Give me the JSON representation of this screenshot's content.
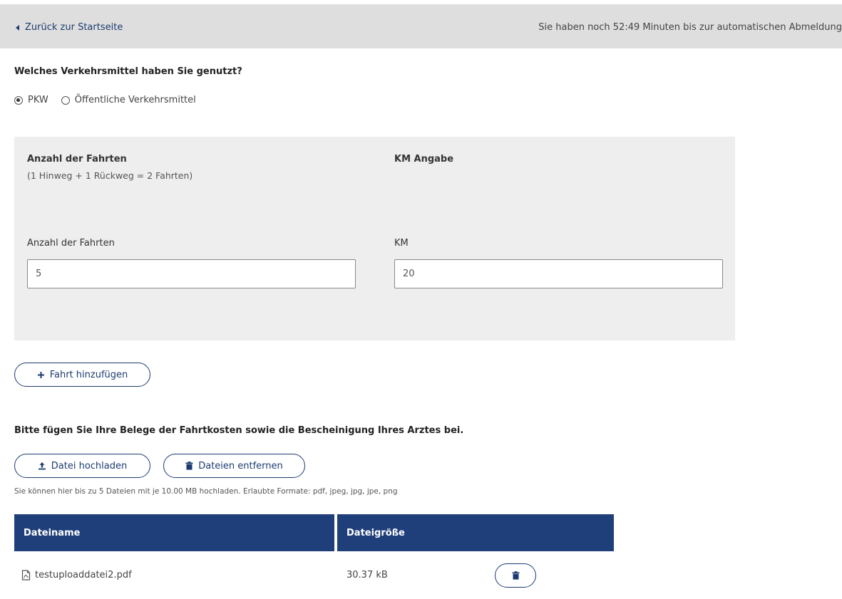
{
  "header": {
    "back_label": "Zurück zur Startseite",
    "timer_text": "Sie haben noch 52:49 Minuten bis zur automatischen Abmeldung"
  },
  "transport": {
    "question": "Welches Verkehrsmittel haben Sie genutzt?",
    "options": [
      {
        "label": "PKW",
        "checked": true
      },
      {
        "label": "Öffentliche Verkehrsmittel",
        "checked": false
      }
    ]
  },
  "trips": {
    "heading_trips": "Anzahl der Fahrten",
    "heading_trips_hint": "(1 Hinweg + 1 Rückweg = 2 Fahrten)",
    "heading_km": "KM Angabe",
    "trips_label": "Anzahl der Fahrten",
    "trips_value": "5",
    "km_label": "KM",
    "km_value": "20",
    "add_trip_label": "Fahrt hinzufügen"
  },
  "upload": {
    "instruction": "Bitte fügen Sie Ihre Belege der Fahrtkosten sowie die Bescheinigung Ihres Arztes bei.",
    "upload_label": "Datei hochladen",
    "remove_label": "Dateien entfernen",
    "note": "Sie können hier bis zu 5 Dateien mit je 10.00 MB hochladen. Erlaubte Formate: pdf, jpeg, jpg, jpe, png"
  },
  "files_table": {
    "columns": [
      "Dateiname",
      "Dateigröße"
    ],
    "rows": [
      {
        "name": "testuploaddatei2.pdf",
        "size": "30.37 kB"
      }
    ]
  },
  "colors": {
    "accent": "#1c3b70",
    "table_header": "#1f3f7a",
    "topbar": "#dedede",
    "panel": "#eeeeee"
  },
  "icons": {
    "back": "caret-left-icon",
    "add": "plus-icon",
    "upload": "upload-icon",
    "remove": "trash-icon",
    "file": "pdf-file-icon",
    "delete_row": "trash-icon"
  }
}
